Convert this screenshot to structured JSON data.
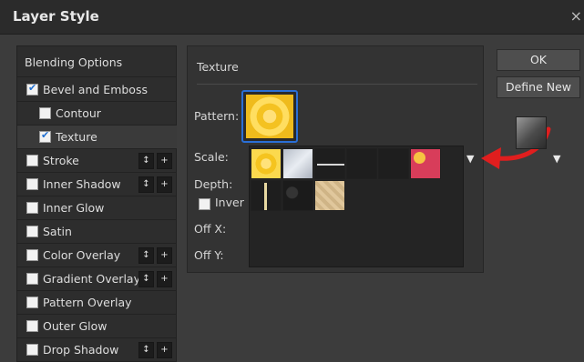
{
  "window": {
    "title": "Layer Style",
    "close_glyph": "×"
  },
  "left_panel": {
    "header": "Blending Options",
    "items": [
      {
        "label": "Bevel and Emboss",
        "checked": true
      },
      {
        "label": "Contour",
        "checked": false
      },
      {
        "label": "Texture",
        "checked": true
      },
      {
        "label": "Stroke",
        "checked": false
      },
      {
        "label": "Inner Shadow",
        "checked": false
      },
      {
        "label": "Inner Glow",
        "checked": false
      },
      {
        "label": "Satin",
        "checked": false
      },
      {
        "label": "Color Overlay",
        "checked": false
      },
      {
        "label": "Gradient Overlay",
        "checked": false
      },
      {
        "label": "Pattern Overlay",
        "checked": false
      },
      {
        "label": "Outer Glow",
        "checked": false
      },
      {
        "label": "Drop Shadow",
        "checked": false
      }
    ],
    "up_down_glyph": "↕",
    "plus_glyph": "+"
  },
  "texture_panel": {
    "title": "Texture",
    "pattern_label": "Pattern:",
    "scale_label": "Scale:",
    "depth_label": "Depth:",
    "invert_label": "Inver",
    "offx_label": "Off X:",
    "offy_label": "Off Y:"
  },
  "dropdown_arrow": "▼",
  "buttons": {
    "ok": "OK",
    "define_new": "Define New"
  },
  "colors": {
    "accent": "#2a6fd6",
    "arrow": "#e01e1e"
  }
}
